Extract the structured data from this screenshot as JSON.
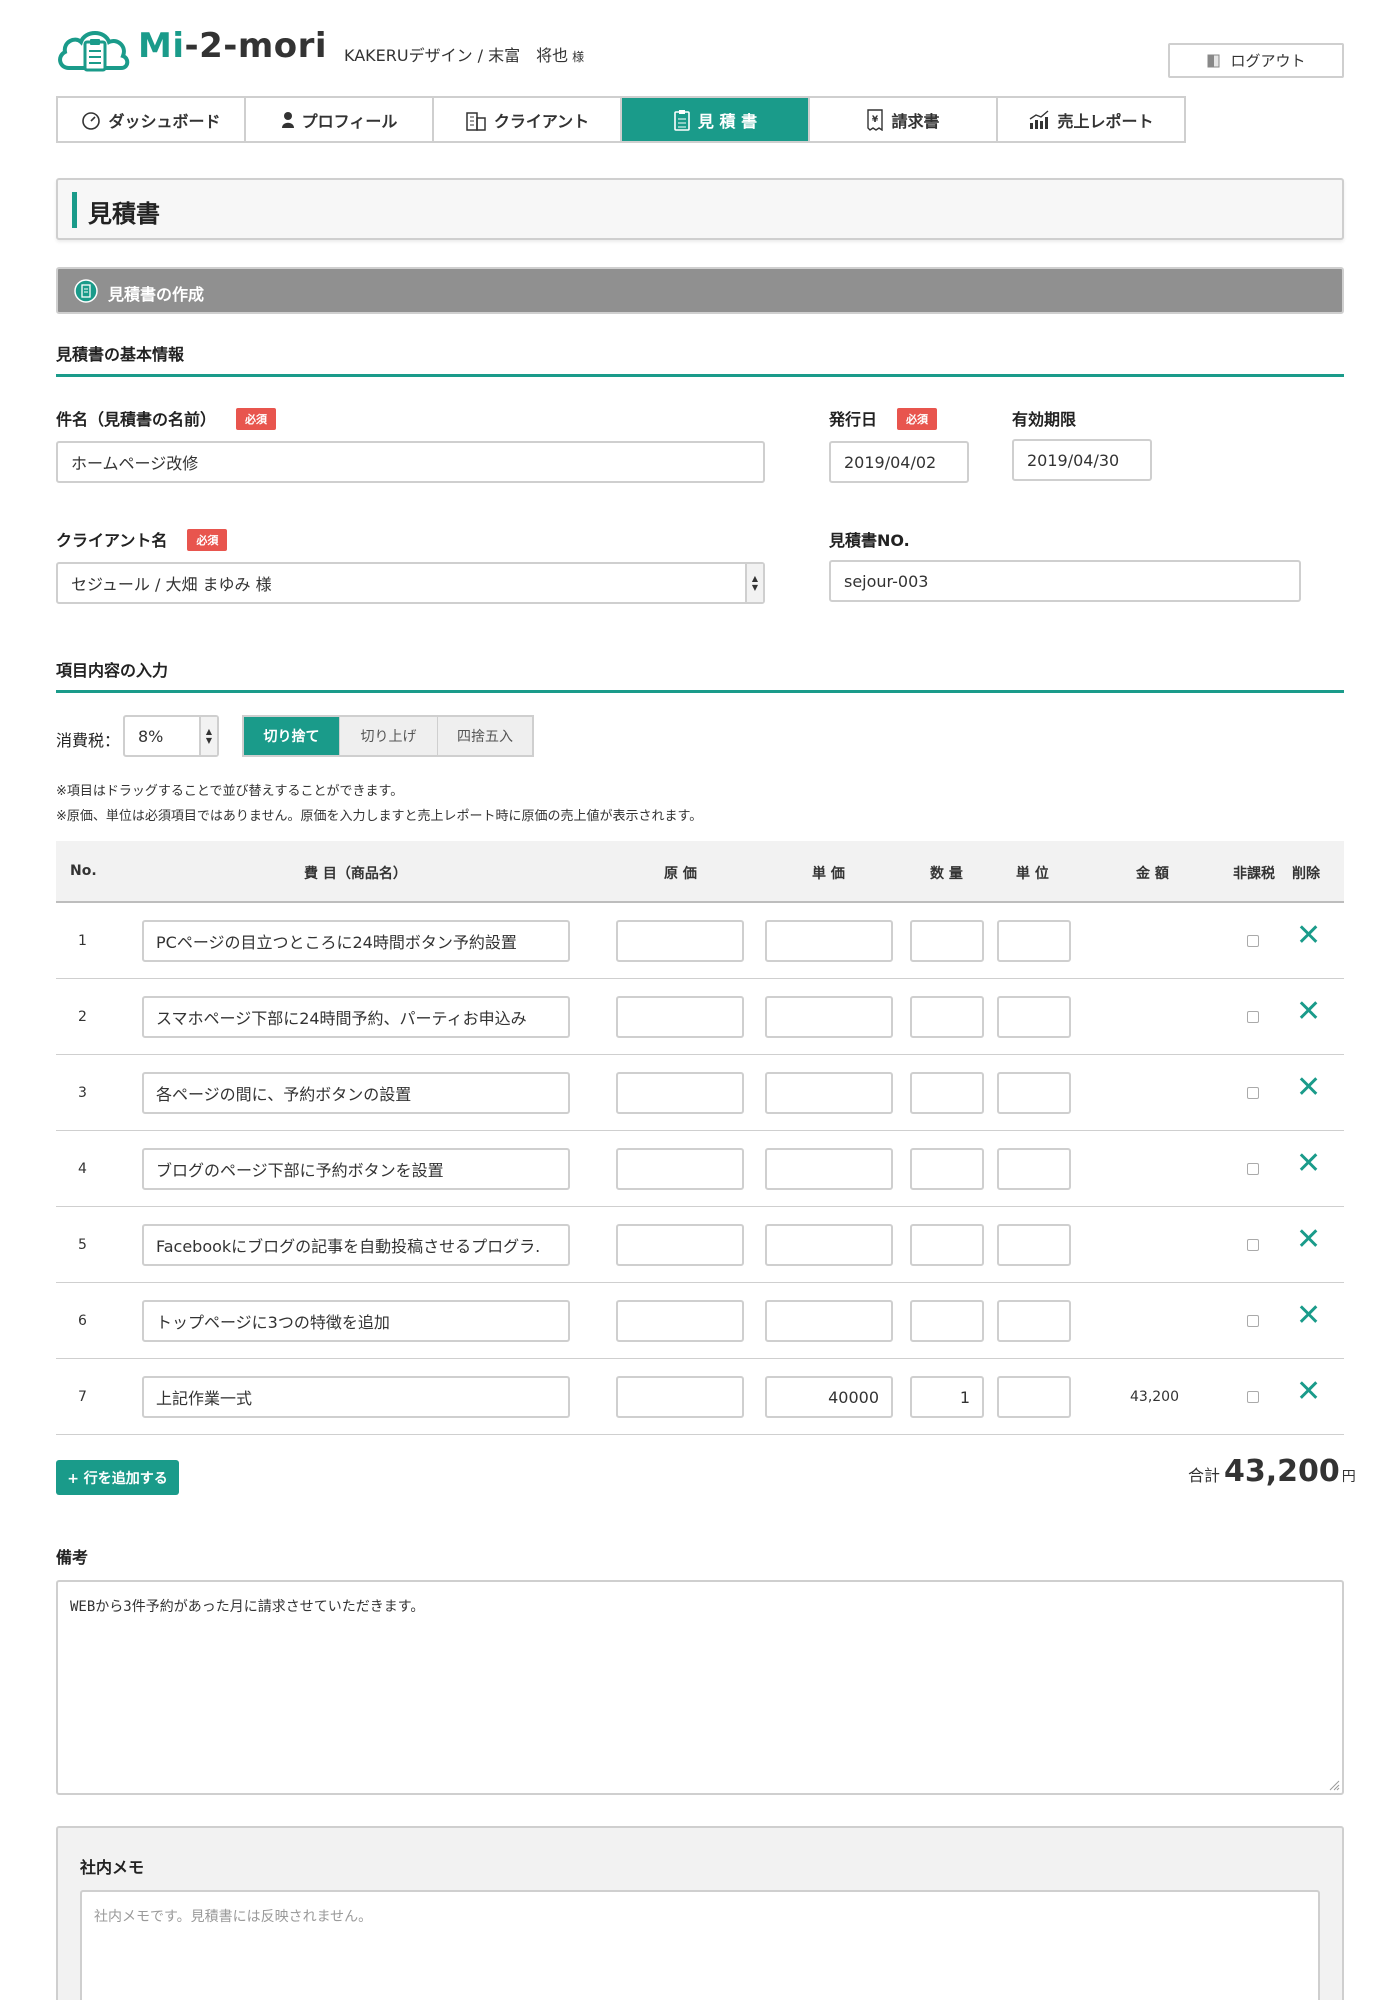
{
  "app": {
    "logo_main": "Mi",
    "logo_rest": "-2-mori"
  },
  "user": {
    "name": "KAKERUデザイン / 末富　将也",
    "honorific": "様"
  },
  "header": {
    "logout_label": "ログアウト"
  },
  "nav": {
    "items": [
      {
        "label": "ダッシュボード",
        "icon": "dashboard-icon"
      },
      {
        "label": "プロフィール",
        "icon": "person-icon"
      },
      {
        "label": "クライアント",
        "icon": "building-icon"
      },
      {
        "label": "見 積 書",
        "icon": "clipboard-icon",
        "active": true
      },
      {
        "label": "請求書",
        "icon": "receipt-icon"
      },
      {
        "label": "売上レポート",
        "icon": "chart-icon"
      }
    ]
  },
  "page": {
    "title": "見積書",
    "section": "見積書の作成"
  },
  "basic": {
    "heading": "見積書の基本情報",
    "subject_label": "件名（見積書の名前）",
    "required": "必須",
    "subject_value": "ホームページ改修",
    "issue_label": "発行日",
    "issue_value": "2019/04/02",
    "expiry_label": "有効期限",
    "expiry_value": "2019/04/30",
    "client_label": "クライアント名",
    "client_value": "セジュール / 大畑 まゆみ 様",
    "no_label": "見積書NO.",
    "no_value": "sejour-003"
  },
  "items_section": {
    "heading": "項目内容の入力",
    "tax_label": "消費税：",
    "tax_value": "8%",
    "rounding": [
      "切り捨て",
      "切り上げ",
      "四捨五入"
    ],
    "note1": "※項目はドラッグすることで並び替えすることができます。",
    "note2": "※原価、単位は必須項目ではありません。原価を入力しますと売上レポート時に原価の売上値が表示されます。"
  },
  "table": {
    "headers": {
      "no": "No.",
      "name": "費 目（商品名）",
      "cost": "原 価",
      "unit_price": "単 価",
      "qty": "数 量",
      "unit": "単 位",
      "amount": "金 額",
      "taxfree": "非課税",
      "delete": "削除"
    },
    "rows": [
      {
        "no": "1",
        "name": "PCページの目立つところに24時間ボタン予約設置",
        "cost": "",
        "price": "",
        "qty": "",
        "unit": "",
        "amount": ""
      },
      {
        "no": "2",
        "name": "スマホページ下部に24時間予約、パーティお申込み",
        "cost": "",
        "price": "",
        "qty": "",
        "unit": "",
        "amount": ""
      },
      {
        "no": "3",
        "name": "各ページの間に、予約ボタンの設置",
        "cost": "",
        "price": "",
        "qty": "",
        "unit": "",
        "amount": ""
      },
      {
        "no": "4",
        "name": "ブログのページ下部に予約ボタンを設置",
        "cost": "",
        "price": "",
        "qty": "",
        "unit": "",
        "amount": ""
      },
      {
        "no": "5",
        "name": "Facebookにブログの記事を自動投稿させるプログラ.",
        "cost": "",
        "price": "",
        "qty": "",
        "unit": "",
        "amount": ""
      },
      {
        "no": "6",
        "name": "トップページに3つの特徴を追加",
        "cost": "",
        "price": "",
        "qty": "",
        "unit": "",
        "amount": ""
      },
      {
        "no": "7",
        "name": "上記作業一式",
        "cost": "",
        "price": "40000",
        "qty": "1",
        "unit": "",
        "amount": "43,200"
      }
    ],
    "delete_symbol": "✕"
  },
  "add_row_label": "+ 行を追加する",
  "total": {
    "label": "合計",
    "value": "43,200",
    "unit": "円"
  },
  "remarks": {
    "label": "備考",
    "value": "WEBから3件予約があった月に請求させていただきます。"
  },
  "memo": {
    "label": "社内メモ",
    "placeholder": "社内メモです。見積書には反映されません。"
  },
  "colors": {
    "accent": "#1a9b8a",
    "required": "#e8554e",
    "section_bg": "#909090"
  }
}
